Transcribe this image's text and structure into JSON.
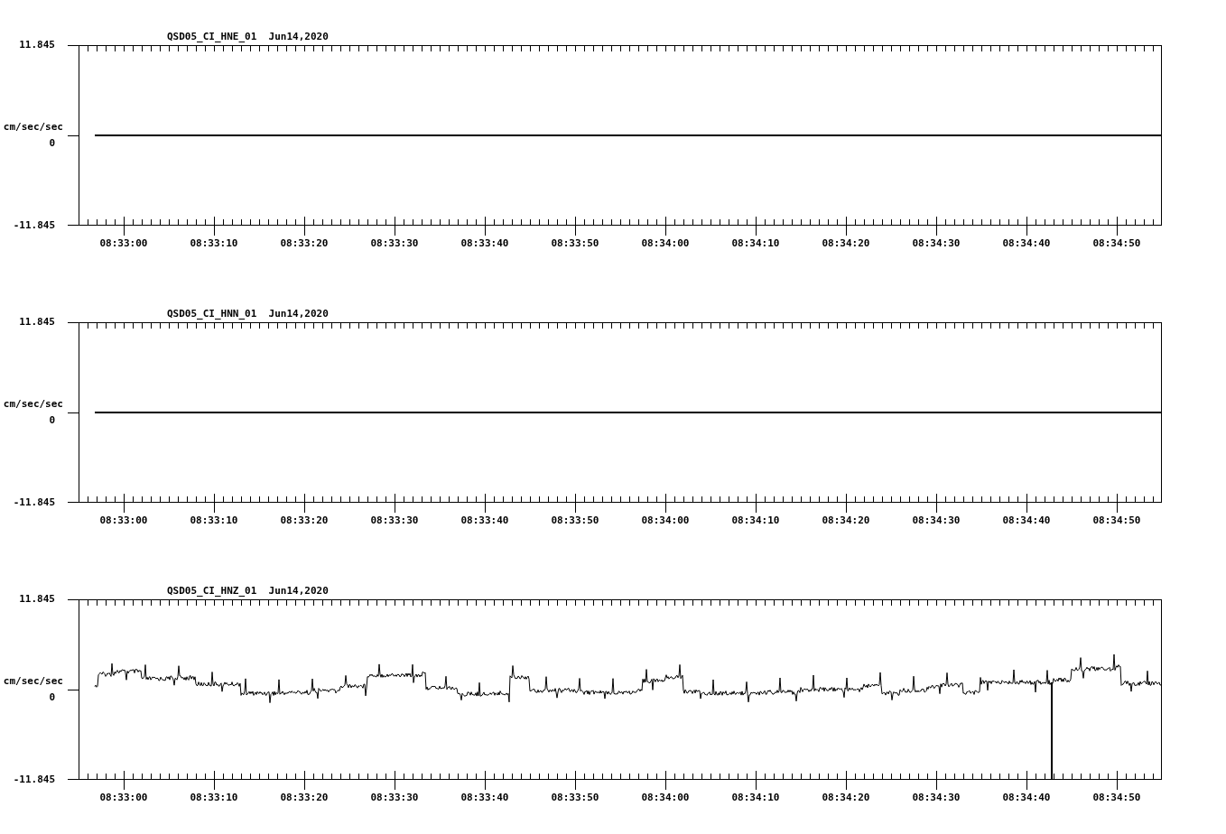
{
  "panels": [
    {
      "title": "QSD05_CI_HNE_01  Jun14,2020",
      "unit": "cm/sec/sec",
      "yticks": [
        "11.845",
        "0",
        "-11.845"
      ],
      "kind": "flat",
      "xticks": [
        "08:33:00",
        "08:33:10",
        "08:33:20",
        "08:33:30",
        "08:33:40",
        "08:33:50",
        "08:34:00",
        "08:34:10",
        "08:34:20",
        "08:34:30",
        "08:34:40",
        "08:34:50"
      ]
    },
    {
      "title": "QSD05_CI_HNN_01  Jun14,2020",
      "unit": "cm/sec/sec",
      "yticks": [
        "11.845",
        "0",
        "-11.845"
      ],
      "kind": "flat",
      "xticks": [
        "08:33:00",
        "08:33:10",
        "08:33:20",
        "08:33:30",
        "08:33:40",
        "08:33:50",
        "08:34:00",
        "08:34:10",
        "08:34:20",
        "08:34:30",
        "08:34:40",
        "08:34:50"
      ]
    },
    {
      "title": "QSD05_CI_HNZ_01  Jun14,2020",
      "unit": "cm/sec/sec",
      "yticks": [
        "11.845",
        "0",
        "-11.845"
      ],
      "kind": "noisy",
      "xticks": [
        "08:33:00",
        "08:33:10",
        "08:33:20",
        "08:33:30",
        "08:33:40",
        "08:33:50",
        "08:34:00",
        "08:34:10",
        "08:34:20",
        "08:34:30",
        "08:34:40",
        "08:34:50"
      ]
    }
  ]
}
